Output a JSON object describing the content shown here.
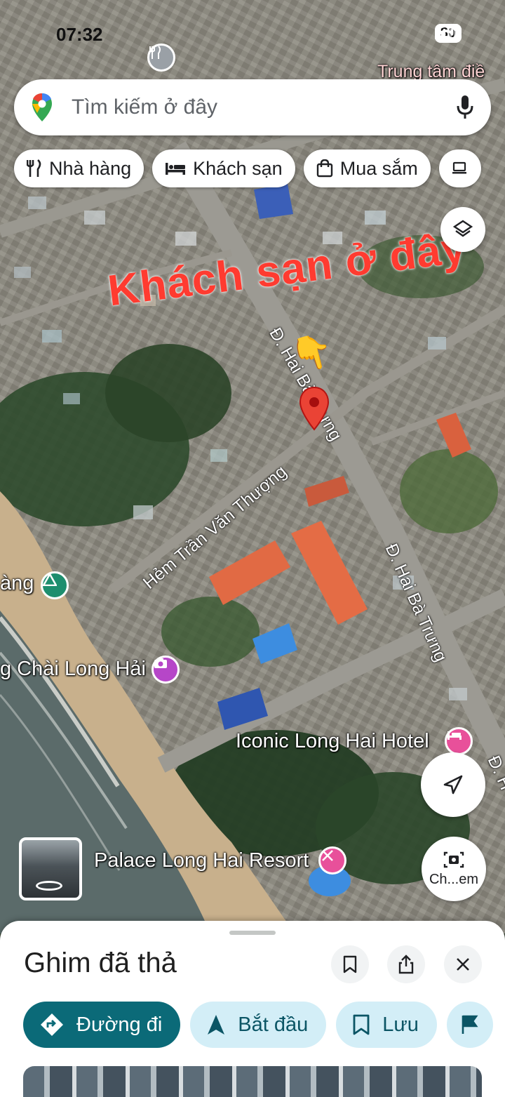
{
  "status_bar": {
    "time": "07:32",
    "battery": "80"
  },
  "search": {
    "placeholder": "Tìm kiếm ở đây"
  },
  "chips": [
    {
      "label": "Nhà hàng",
      "icon": "fork-knife-icon"
    },
    {
      "label": "Khách sạn",
      "icon": "bed-icon"
    },
    {
      "label": "Mua sắm",
      "icon": "shopping-bag-icon"
    }
  ],
  "map": {
    "overlay_text": "Khách sạn ở đây",
    "pointing_emoji": "👇",
    "labels": {
      "trung_tam": "Trung tâm điề",
      "road_hai_ba_trung_top": "Đ. Hai Bà Trưng",
      "road_hai_ba_trung_right": "Đ. Hai Bà Trưng",
      "hem_tran_van_thuong": "Hẻm Trần Văn Thượng",
      "hang": "àng",
      "cho_chai": "g Chài Long Hải",
      "iconic_hotel": "Iconic Long Hai Hotel",
      "palace_resort": "Palace Long Hai Resort",
      "right_edge": "Đ. H"
    },
    "camera_button_label": "Ch...em"
  },
  "sheet": {
    "title": "Ghim đã thả",
    "actions": [
      {
        "label": "Đường đi",
        "icon": "directions-icon"
      },
      {
        "label": "Bắt đầu",
        "icon": "navigation-arrow-icon"
      },
      {
        "label": "Lưu",
        "icon": "bookmark-icon"
      }
    ]
  },
  "colors": {
    "accent": "#0b6a78",
    "pin": "#ea4335",
    "overlay": "#ff3b30"
  }
}
